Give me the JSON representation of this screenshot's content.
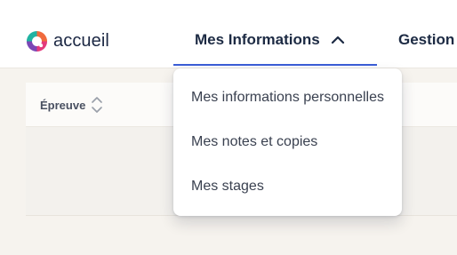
{
  "header": {
    "logo_text": "accueil",
    "nav": [
      {
        "label": "Mes Informations"
      },
      {
        "label": "Gestion"
      }
    ]
  },
  "table": {
    "columns": [
      {
        "label": "Épreuve"
      }
    ]
  },
  "dropdown": {
    "items": [
      {
        "label": "Mes informations personnelles"
      },
      {
        "label": "Mes notes et copies"
      },
      {
        "label": "Mes stages"
      }
    ]
  },
  "icons": {
    "logo": "logo-mark-icon",
    "chevron": "chevron-up-icon",
    "sort": "sort-icon"
  },
  "colors": {
    "accent": "#3b5ed6",
    "nav_text": "#1c2a43",
    "muted_text": "#495061"
  }
}
